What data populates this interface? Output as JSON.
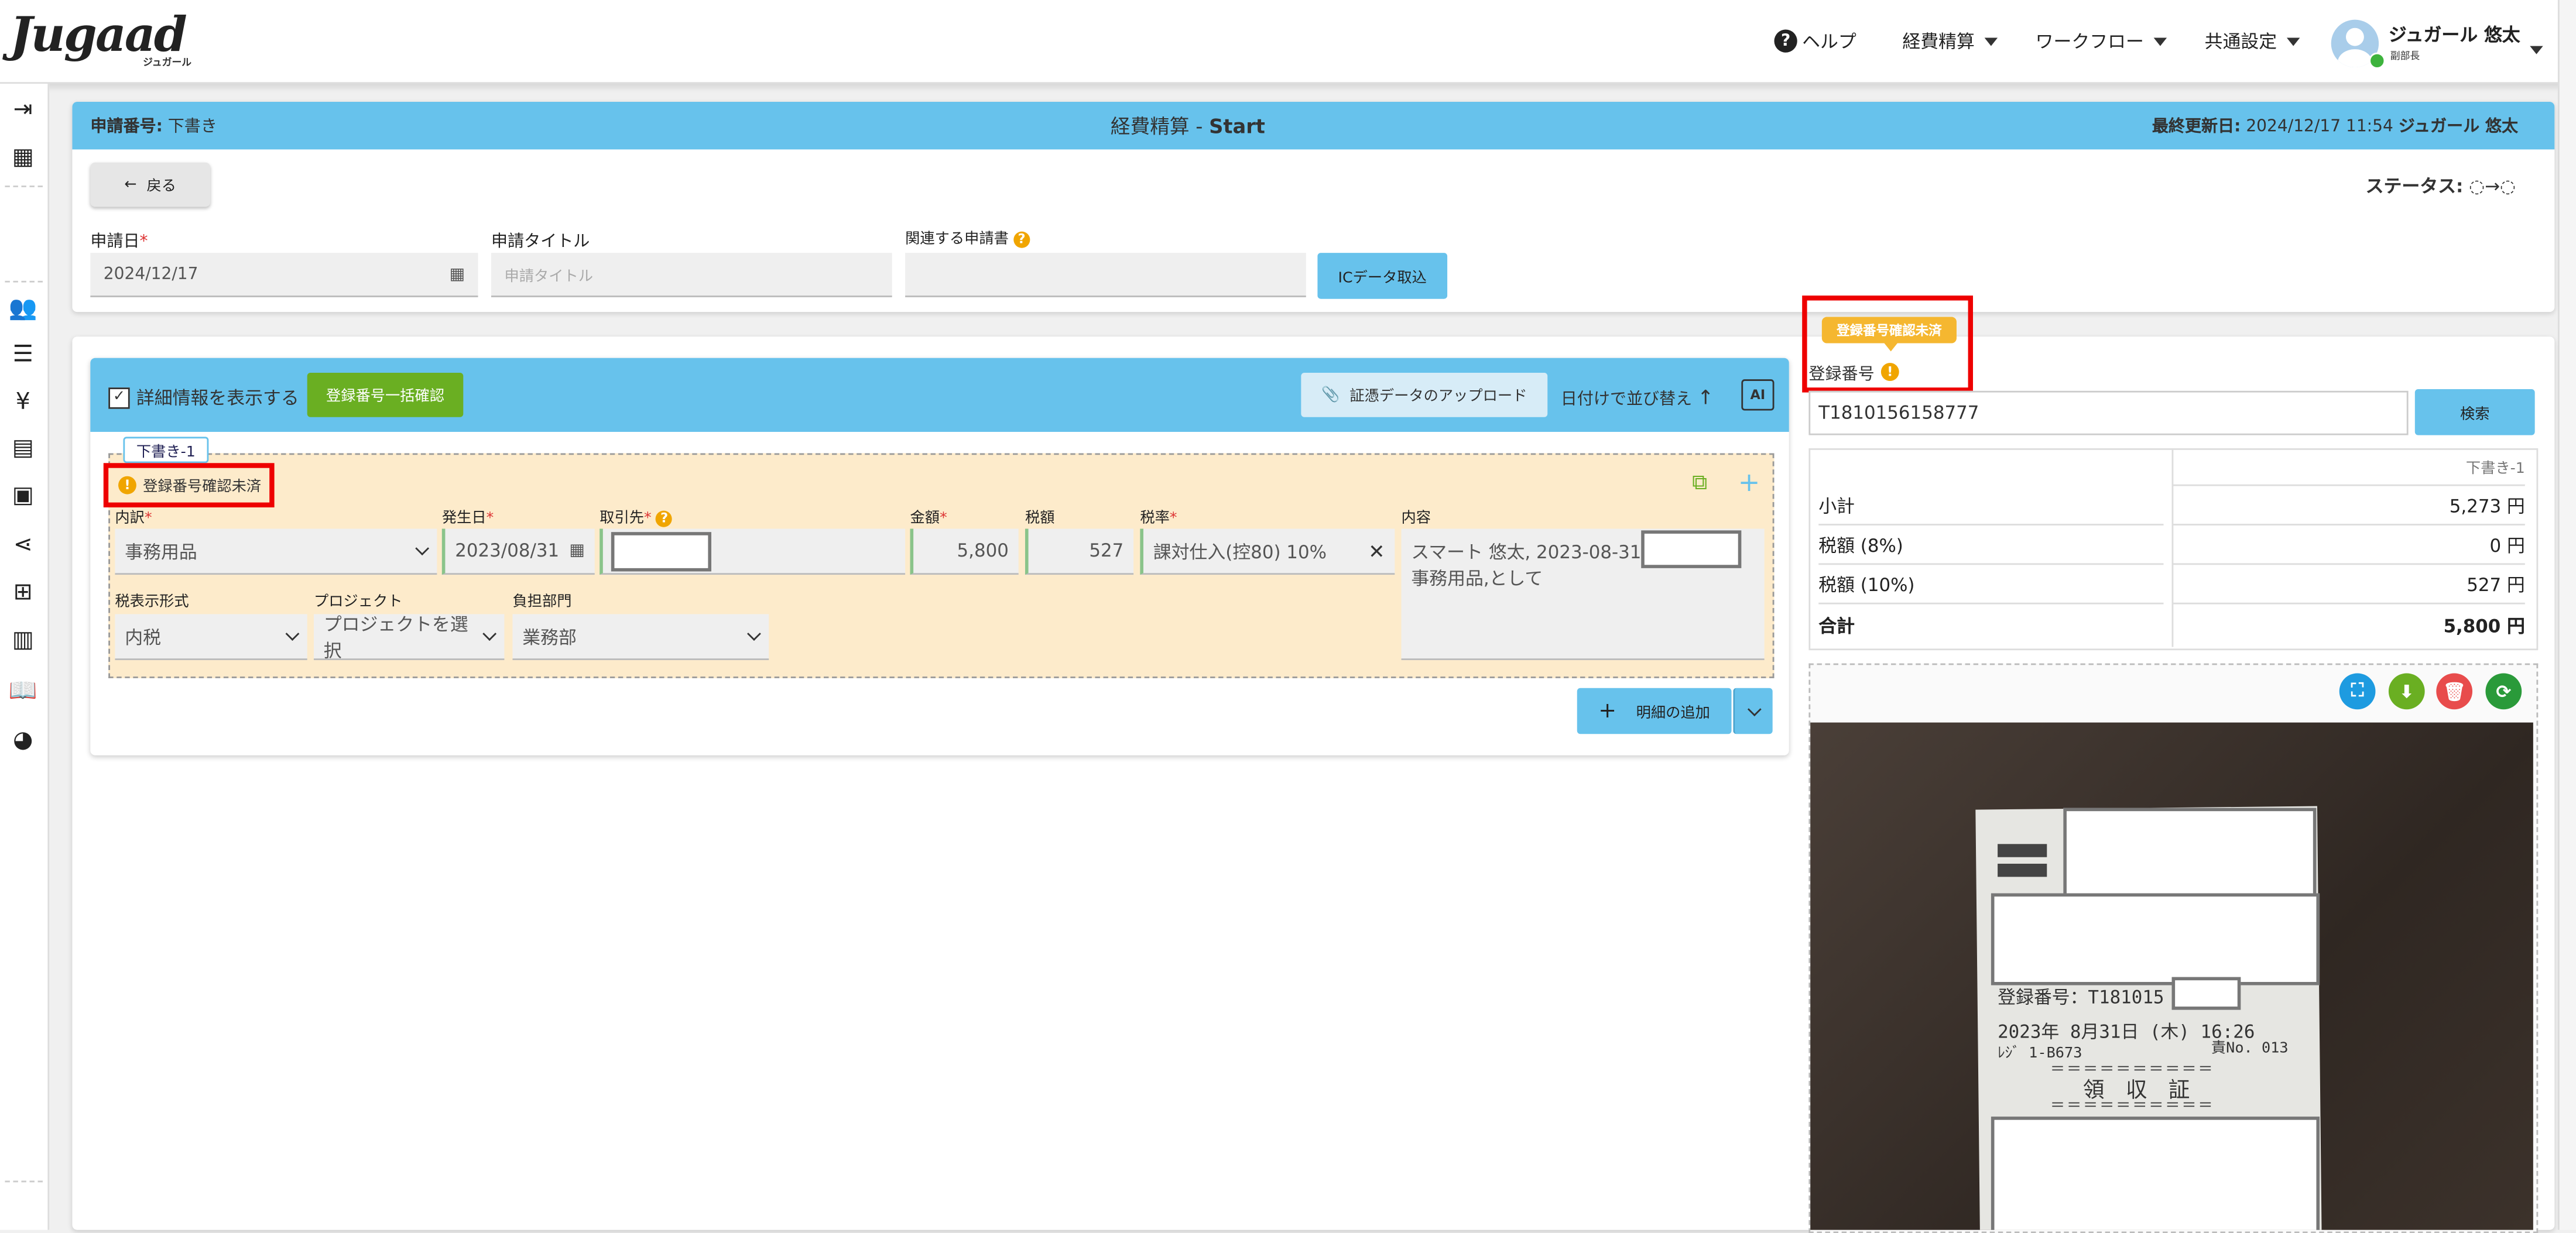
{
  "header": {
    "logo": "Jugaad",
    "logo_sub": "ジュガール",
    "help": "ヘルプ",
    "nav": [
      "経費精算",
      "ワークフロー",
      "共通設定"
    ],
    "user_name": "ジュガール 悠太",
    "user_role": "副部長"
  },
  "titlebar": {
    "app_no_label": "申請番号:",
    "app_no_value": "下書き",
    "title": "経費精算 - ",
    "title_strong": "Start",
    "updated_label": "最終更新日:",
    "updated_value": "2024/12/17 11:54",
    "updated_user": "ジュガール 悠太"
  },
  "form": {
    "back": "戻る",
    "status_label": "ステータス:",
    "date_label": "申請日",
    "date_value": "2024/12/17",
    "title_label": "申請タイトル",
    "title_placeholder": "申請タイトル",
    "related_label": "関連する申請書",
    "ic_button": "ICデータ取込"
  },
  "detail": {
    "show_detail": "詳細情報を表示する",
    "bulk_confirm": "登録番号一括確認",
    "upload": "証憑データのアップロード",
    "sort": "日付けで並び替え",
    "ai": "AI",
    "tab": "下書き-1",
    "warning": "登録番号確認未済",
    "labels": {
      "breakdown": "内訳",
      "date": "発生日",
      "vendor": "取引先",
      "amount": "金額",
      "tax": "税額",
      "rate": "税率",
      "content": "内容",
      "tax_display": "税表示形式",
      "project": "プロジェクト",
      "dept": "負担部門"
    },
    "values": {
      "breakdown": "事務用品",
      "date": "2023/08/31",
      "amount": "5,800",
      "tax": "527",
      "rate": "課対仕入(控80) 10%",
      "content": "スマート 悠太, 2023-08-31,",
      "content2": "事務用品,として",
      "tax_display": "内税",
      "project": "プロジェクトを選択",
      "dept": "業務部"
    },
    "add_detail": "明細の追加"
  },
  "right": {
    "tooltip": "登録番号確認未済",
    "reg_label": "登録番号",
    "reg_value": "T1810156158777",
    "search": "検索",
    "col_header": "下書き-1",
    "rows": [
      {
        "label": "小計",
        "value": "5,273 円"
      },
      {
        "label": "税額 (8%)",
        "value": "0 円"
      },
      {
        "label": "税額 (10%)",
        "value": "527 円"
      },
      {
        "label": "合計",
        "value": "5,800 円"
      }
    ]
  },
  "receipt": {
    "reg_line": "登録番号：T181015",
    "date_line": "2023年 8月31日 (木) 16:26",
    "register_line": "ﾚｼﾞ 1-B673",
    "no_line": "責No. 013",
    "equals": "＝＝＝＝＝＝＝＝＝＝",
    "title": "領　収　証"
  }
}
